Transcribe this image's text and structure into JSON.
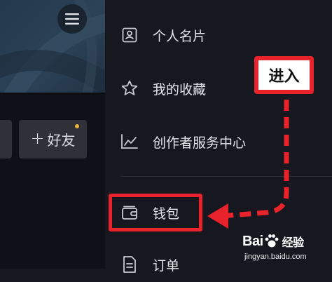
{
  "left_panel": {
    "add_friend_label": "好友",
    "add_friend_plus": "+",
    "menu_icon": "hamburger-icon",
    "notify_color": "#e9b13a"
  },
  "drawer": {
    "items": [
      {
        "icon": "id-card-icon",
        "label": "个人名片"
      },
      {
        "icon": "star-icon",
        "label": "我的收藏"
      },
      {
        "icon": "line-chart-icon",
        "label": "创作者服务中心"
      },
      {
        "icon": "wallet-icon",
        "label": "钱包"
      },
      {
        "icon": "document-icon",
        "label": "订单"
      }
    ]
  },
  "annotation": {
    "label": "进入",
    "color": "#e8232b"
  },
  "watermark": {
    "brand": "Bai",
    "brand_suffix": "经验",
    "url": "jingyan.baidu.com"
  }
}
